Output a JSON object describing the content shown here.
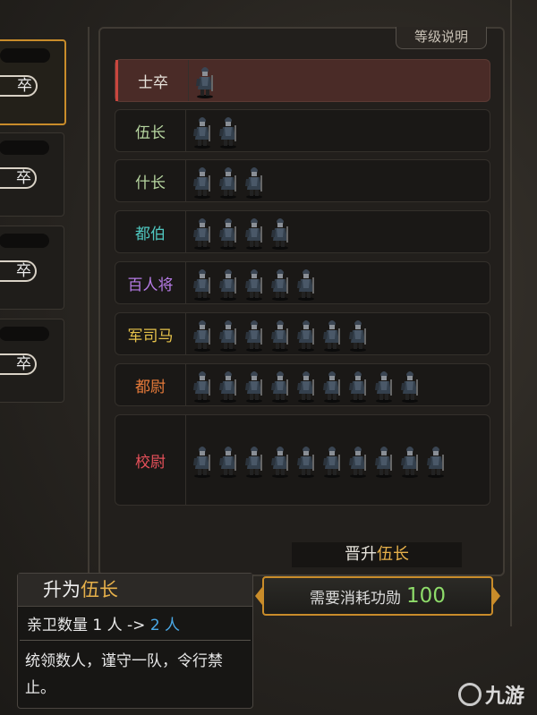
{
  "panel_tab_label": "等级说明",
  "left_tags": [
    "卒",
    "卒",
    "卒",
    "卒"
  ],
  "ranks": [
    {
      "name": "士卒",
      "count": 1,
      "color": "#e8e4dc",
      "selected": true
    },
    {
      "name": "伍长",
      "count": 2,
      "color": "#b7d6a0",
      "selected": false
    },
    {
      "name": "什长",
      "count": 3,
      "color": "#b7d6a0",
      "selected": false
    },
    {
      "name": "都伯",
      "count": 4,
      "color": "#4fc7c0",
      "selected": false
    },
    {
      "name": "百人将",
      "count": 5,
      "color": "#b67be6",
      "selected": false
    },
    {
      "name": "军司马",
      "count": 7,
      "color": "#e6c24a",
      "selected": false
    },
    {
      "name": "都尉",
      "count": 9,
      "color": "#e67a3a",
      "selected": false
    },
    {
      "name": "校尉",
      "count": 10,
      "color": "#e6505a",
      "selected": false
    }
  ],
  "promote": {
    "prefix": "晋升",
    "target": "伍长"
  },
  "cost": {
    "label": "需要消耗功勋",
    "value": "100"
  },
  "tooltip": {
    "title_prefix": "升为",
    "title_rank": "伍长",
    "guard_label": "亲卫数量 1 人 ->",
    "guard_new": "2 人",
    "desc": "统领数人，谨守一队，令行禁止。"
  },
  "watermark": "九游",
  "colors": {
    "accent": "#c98c2a",
    "cost_value": "#8edc6a",
    "highlight": "#e6b04a",
    "guard_new": "#4aa8e6"
  }
}
